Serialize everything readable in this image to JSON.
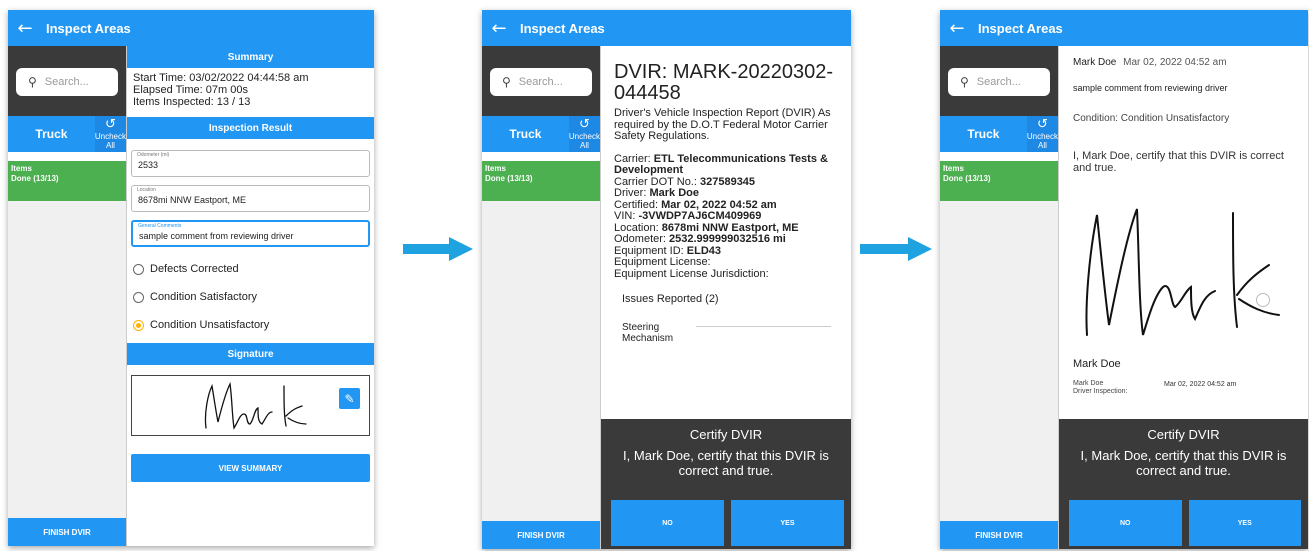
{
  "common": {
    "back_icon": "arrow-left-icon",
    "title": "Inspect Areas",
    "search_placeholder": "Search...",
    "truck_label": "Truck",
    "uncheck_label": "Uncheck All",
    "items_label": "Items",
    "items_status": "Done (13/13)",
    "finish_label": "FINISH DVIR",
    "accent": "#2196f3",
    "done_color": "#4caf50"
  },
  "screen1": {
    "summary_header": "Summary",
    "start_time": "Start Time: 03/02/2022 04:44:58 am",
    "elapsed_time": "Elapsed Time: 07m 00s",
    "items_inspected": "Items Inspected: 13 / 13",
    "result_header": "Inspection Result",
    "odometer_label": "Odometer (mi)",
    "odometer_value": "2533",
    "location_label": "Location",
    "location_value": "8678mi NNW Eastport, ME",
    "comments_label": "General Comments",
    "comments_value": "sample comment from reviewing driver",
    "radio_defects": "Defects Corrected",
    "radio_satisfactory": "Condition Satisfactory",
    "radio_unsatisfactory": "Condition Unsatisfactory",
    "selected_radio": "Condition Unsatisfactory",
    "signature_header": "Signature",
    "view_summary": "VIEW SUMMARY"
  },
  "screen2": {
    "report_title": "DVIR: MARK-20220302-044458",
    "intro": "Driver's Vehicle Inspection Report (DVIR) As required by the D.O.T Federal Motor Carrier Safety Regulations.",
    "carrier_label": "Carrier:",
    "carrier_value": "ETL Telecommunications Tests & Development",
    "dot_label": "Carrier DOT No.:",
    "dot_value": "327589345",
    "driver_label": "Driver:",
    "driver_value": "Mark Doe",
    "certified_label": "Certified:",
    "certified_value": "Mar 02, 2022  04:52 am",
    "vin_label": "VIN:",
    "vin_value": "-3VWDP7AJ6CM409969",
    "location_label": "Location:",
    "location_value": "8678mi NNW Eastport, ME",
    "odometer_label": "Odometer:",
    "odometer_value": "2532.999999032516 mi",
    "equipment_label": "Equipment ID:",
    "equipment_value": "ELD43",
    "license_label": "Equipment License:",
    "jurisdiction_label": "Equipment License Jurisdiction:",
    "issues_label": "Issues Reported (2)",
    "issue1": "Steering Mechanism"
  },
  "screen3": {
    "author": "Mark Doe",
    "timestamp": "Mar 02, 2022 04:52 am",
    "comment": "sample comment from reviewing driver",
    "condition": "Condition: Condition Unsatisfactory",
    "certify_text": "I, Mark Doe, certify that this DVIR is correct and true.",
    "signer_name": "Mark Doe",
    "sub_name": "Mark Doe",
    "sub_role": "Driver Inspection:",
    "sub_date": "Mar 02, 2022  04:52 am"
  },
  "certify": {
    "title": "Certify DVIR",
    "body": "I, Mark Doe, certify that this DVIR is correct and true.",
    "no": "NO",
    "yes": "YES"
  },
  "arrows": {
    "color": "#1fa2e0"
  }
}
